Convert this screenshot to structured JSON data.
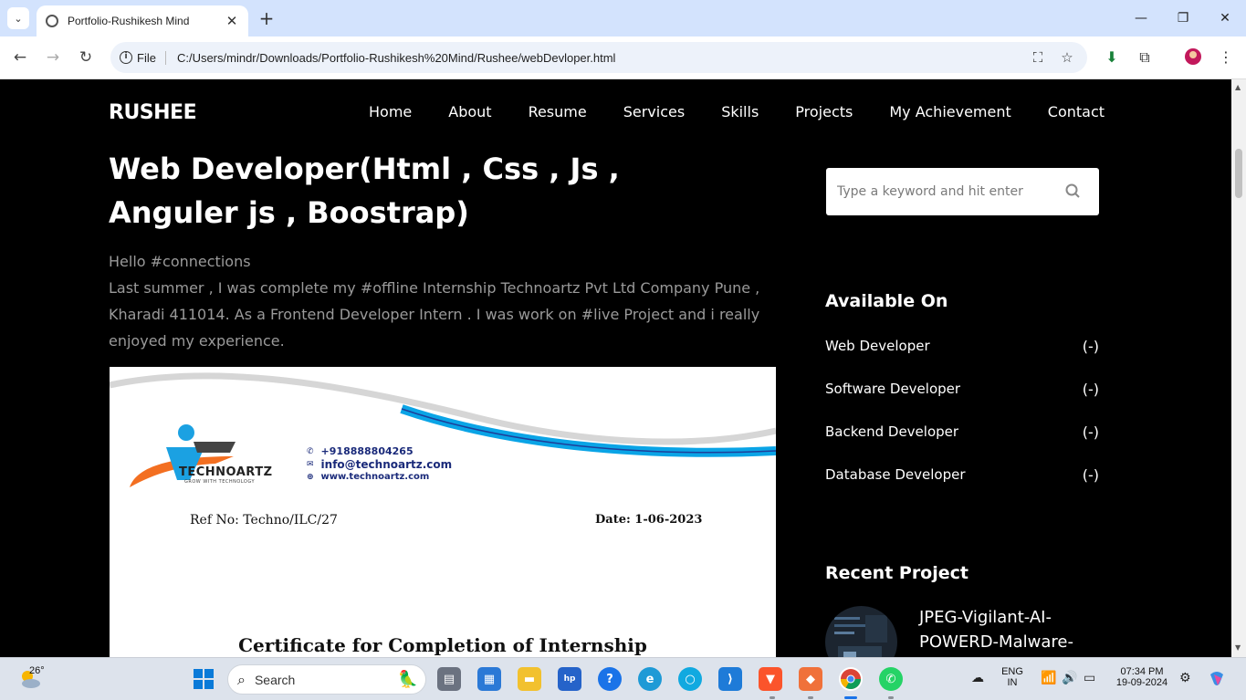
{
  "browser": {
    "tab_title": "Portfolio-Rushikesh Mind",
    "omnibox_file_label": "File",
    "url": "C:/Users/mindr/Downloads/Portfolio-Rushikesh%20Mind/Rushee/webDevloper.html"
  },
  "site": {
    "brand": "RUSHEE",
    "nav": [
      "Home",
      "About",
      "Resume",
      "Services",
      "Skills",
      "Projects",
      "My Achievement",
      "Contact"
    ]
  },
  "post": {
    "title": "Web Developer(Html , Css , Js , Anguler js , Boostrap)",
    "greeting": "Hello #connections",
    "body": "Last summer , I was complete my #offline Internship Technoartz Pvt Ltd Company Pune , Kharadi 411014. As a Frontend Developer Intern . I was work on #live Project and i really enjoyed my experience."
  },
  "certificate": {
    "logo_text": "TECHNOARTZ",
    "logo_tagline": "GROW WITH TECHNOLOGY",
    "phone": "+918888804265",
    "email": "info@technoartz.com",
    "website": "www.technoartz.com",
    "ref": "Ref No: Techno/ILC/27",
    "date": "Date: 1-06-2023",
    "heading": "Certificate for Completion of Internship"
  },
  "sidebar": {
    "search_placeholder": "Type a keyword and hit enter",
    "available_heading": "Available On",
    "available": [
      {
        "label": "Web Developer",
        "count": "(-)"
      },
      {
        "label": "Software Developer",
        "count": "(-)"
      },
      {
        "label": "Backend Developer",
        "count": "(-)"
      },
      {
        "label": "Database Developer",
        "count": "(-)"
      }
    ],
    "recent_heading": "Recent Project",
    "recent_title": "JPEG-Vigilant-AI-POWERD-Malware-"
  },
  "taskbar": {
    "temperature": "26°",
    "search_label": "Search",
    "lang_line1": "ENG",
    "lang_line2": "IN",
    "time": "07:34 PM",
    "date": "19-09-2024"
  },
  "colors": {
    "page_bg": "#000000",
    "chrome_tabbar": "#d3e3fd",
    "cert_swoosh_blue": "#0aa4e6",
    "cert_logo_orange": "#f36f21",
    "cert_logo_blue": "#1ba1e2"
  }
}
